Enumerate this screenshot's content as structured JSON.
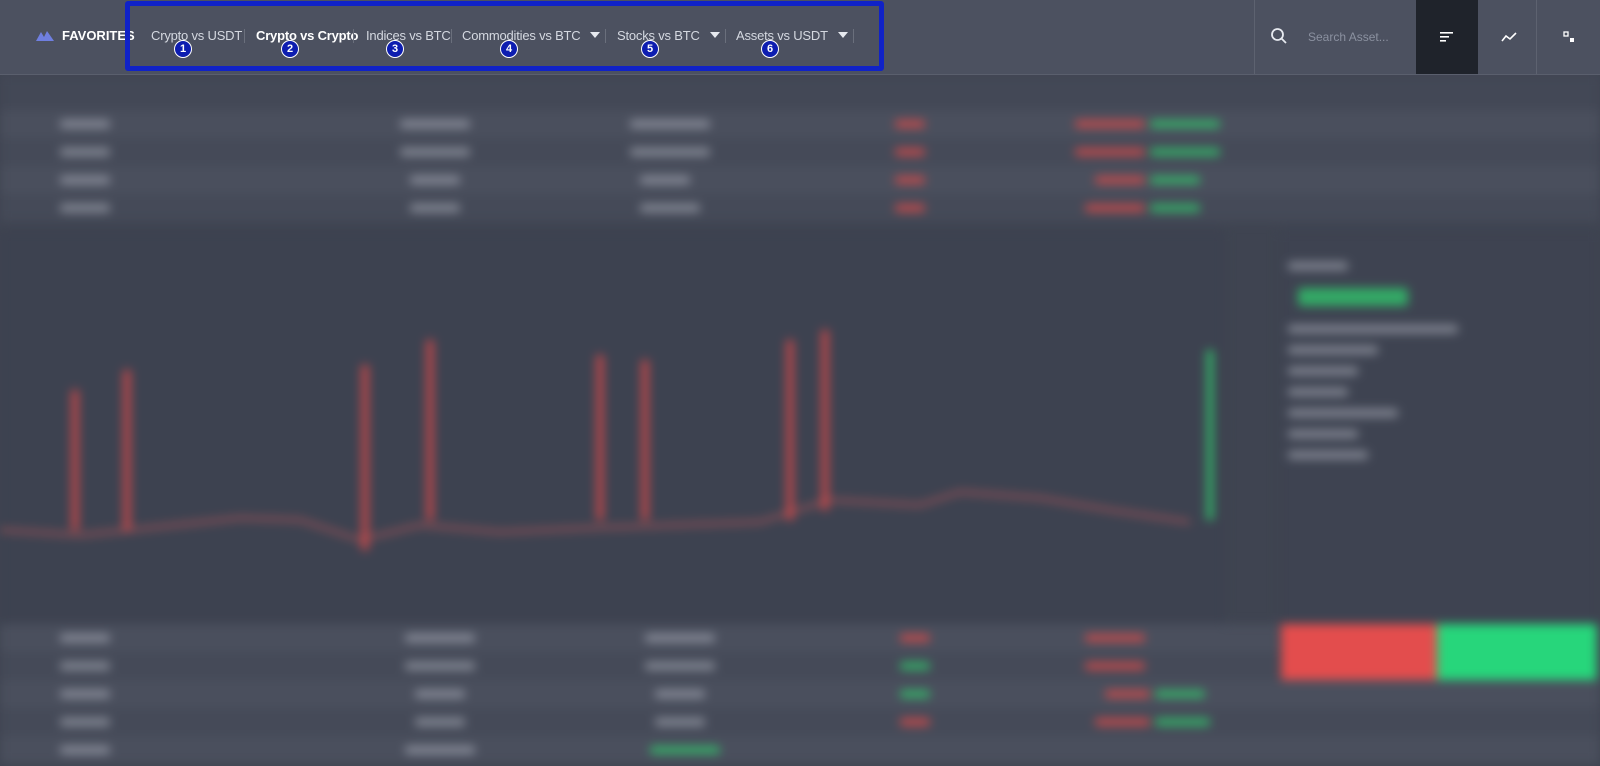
{
  "favorites": {
    "label": "FAVORITES",
    "icon": "mountain-logo-icon"
  },
  "tabs": [
    {
      "label": "Crypto vs USDT",
      "badge": "1",
      "active": false,
      "has_dropdown": false
    },
    {
      "label": "Crypto vs Crypto",
      "badge": "2",
      "active": true,
      "has_dropdown": false
    },
    {
      "label": "Indices vs BTC",
      "badge": "3",
      "active": false,
      "has_dropdown": false
    },
    {
      "label": "Commodities vs BTC",
      "badge": "4",
      "active": false,
      "has_dropdown": true
    },
    {
      "label": "Stocks vs BTC",
      "badge": "5",
      "active": false,
      "has_dropdown": true
    },
    {
      "label": "Assets vs USDT",
      "badge": "6",
      "active": false,
      "has_dropdown": true
    }
  ],
  "search": {
    "placeholder": "Search Asset...",
    "icon": "search-icon"
  },
  "tools": [
    {
      "icon": "list-view-icon",
      "active": true
    },
    {
      "icon": "line-chart-icon",
      "active": false
    },
    {
      "icon": "grid-layout-icon",
      "active": false
    }
  ],
  "colors": {
    "highlight_border": "#1022c7",
    "badge_bg": "#0d1db0",
    "sell": "#e34d4d",
    "buy": "#27d67b"
  }
}
